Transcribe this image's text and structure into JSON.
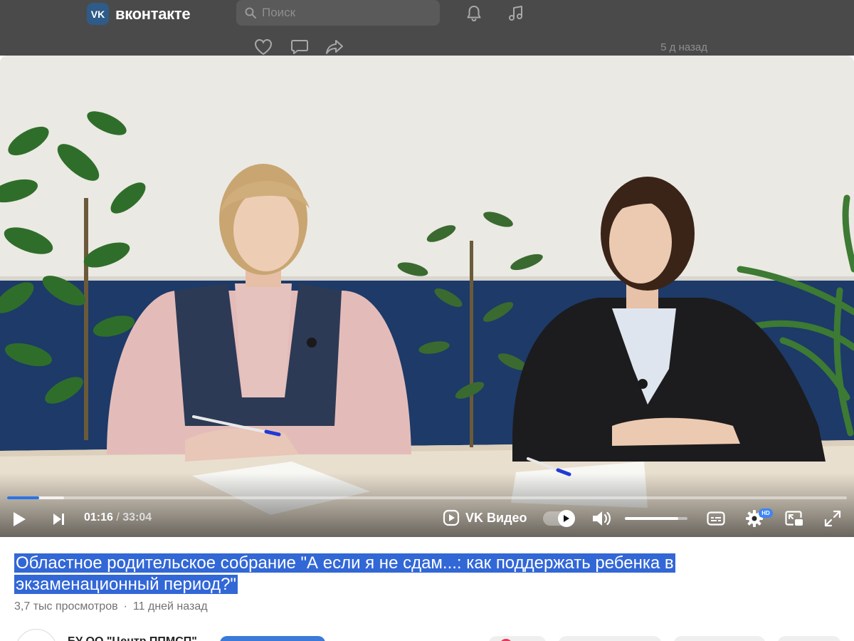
{
  "header": {
    "logo_text": "вконтакте",
    "logo_badge": "VK",
    "search_placeholder": "Поиск",
    "icons": [
      "bell-icon",
      "music-note-icon"
    ]
  },
  "post": {
    "actions": [
      "heart-icon",
      "comment-icon",
      "share-icon"
    ],
    "time": "5 д назад"
  },
  "player": {
    "current_time": "01:16",
    "separator": "/",
    "duration": "33:04",
    "progress_fraction": 0.038,
    "buffered_fraction": 0.068,
    "volume_fraction": 0.85,
    "brand": "VK Видео",
    "hd_badge": "HD",
    "autoplay_toggle_on": true,
    "icons": [
      "play-icon",
      "next-icon",
      "vk-video-icon",
      "autoplay-toggle",
      "volume-icon",
      "subtitles-icon",
      "settings-icon",
      "pip-icon",
      "fullscreen-icon"
    ],
    "accent_color": "#2b73e4"
  },
  "video": {
    "title": "Областное родительское собрание \"А если я не сдам...: как поддержать ребенка в экзаменационный период?\"",
    "views": "3,7 тыс просмотров",
    "dot": "·",
    "posted": "11 дней назад"
  },
  "channel": {
    "name": "БУ ОО \"Центр ППМСП\""
  }
}
